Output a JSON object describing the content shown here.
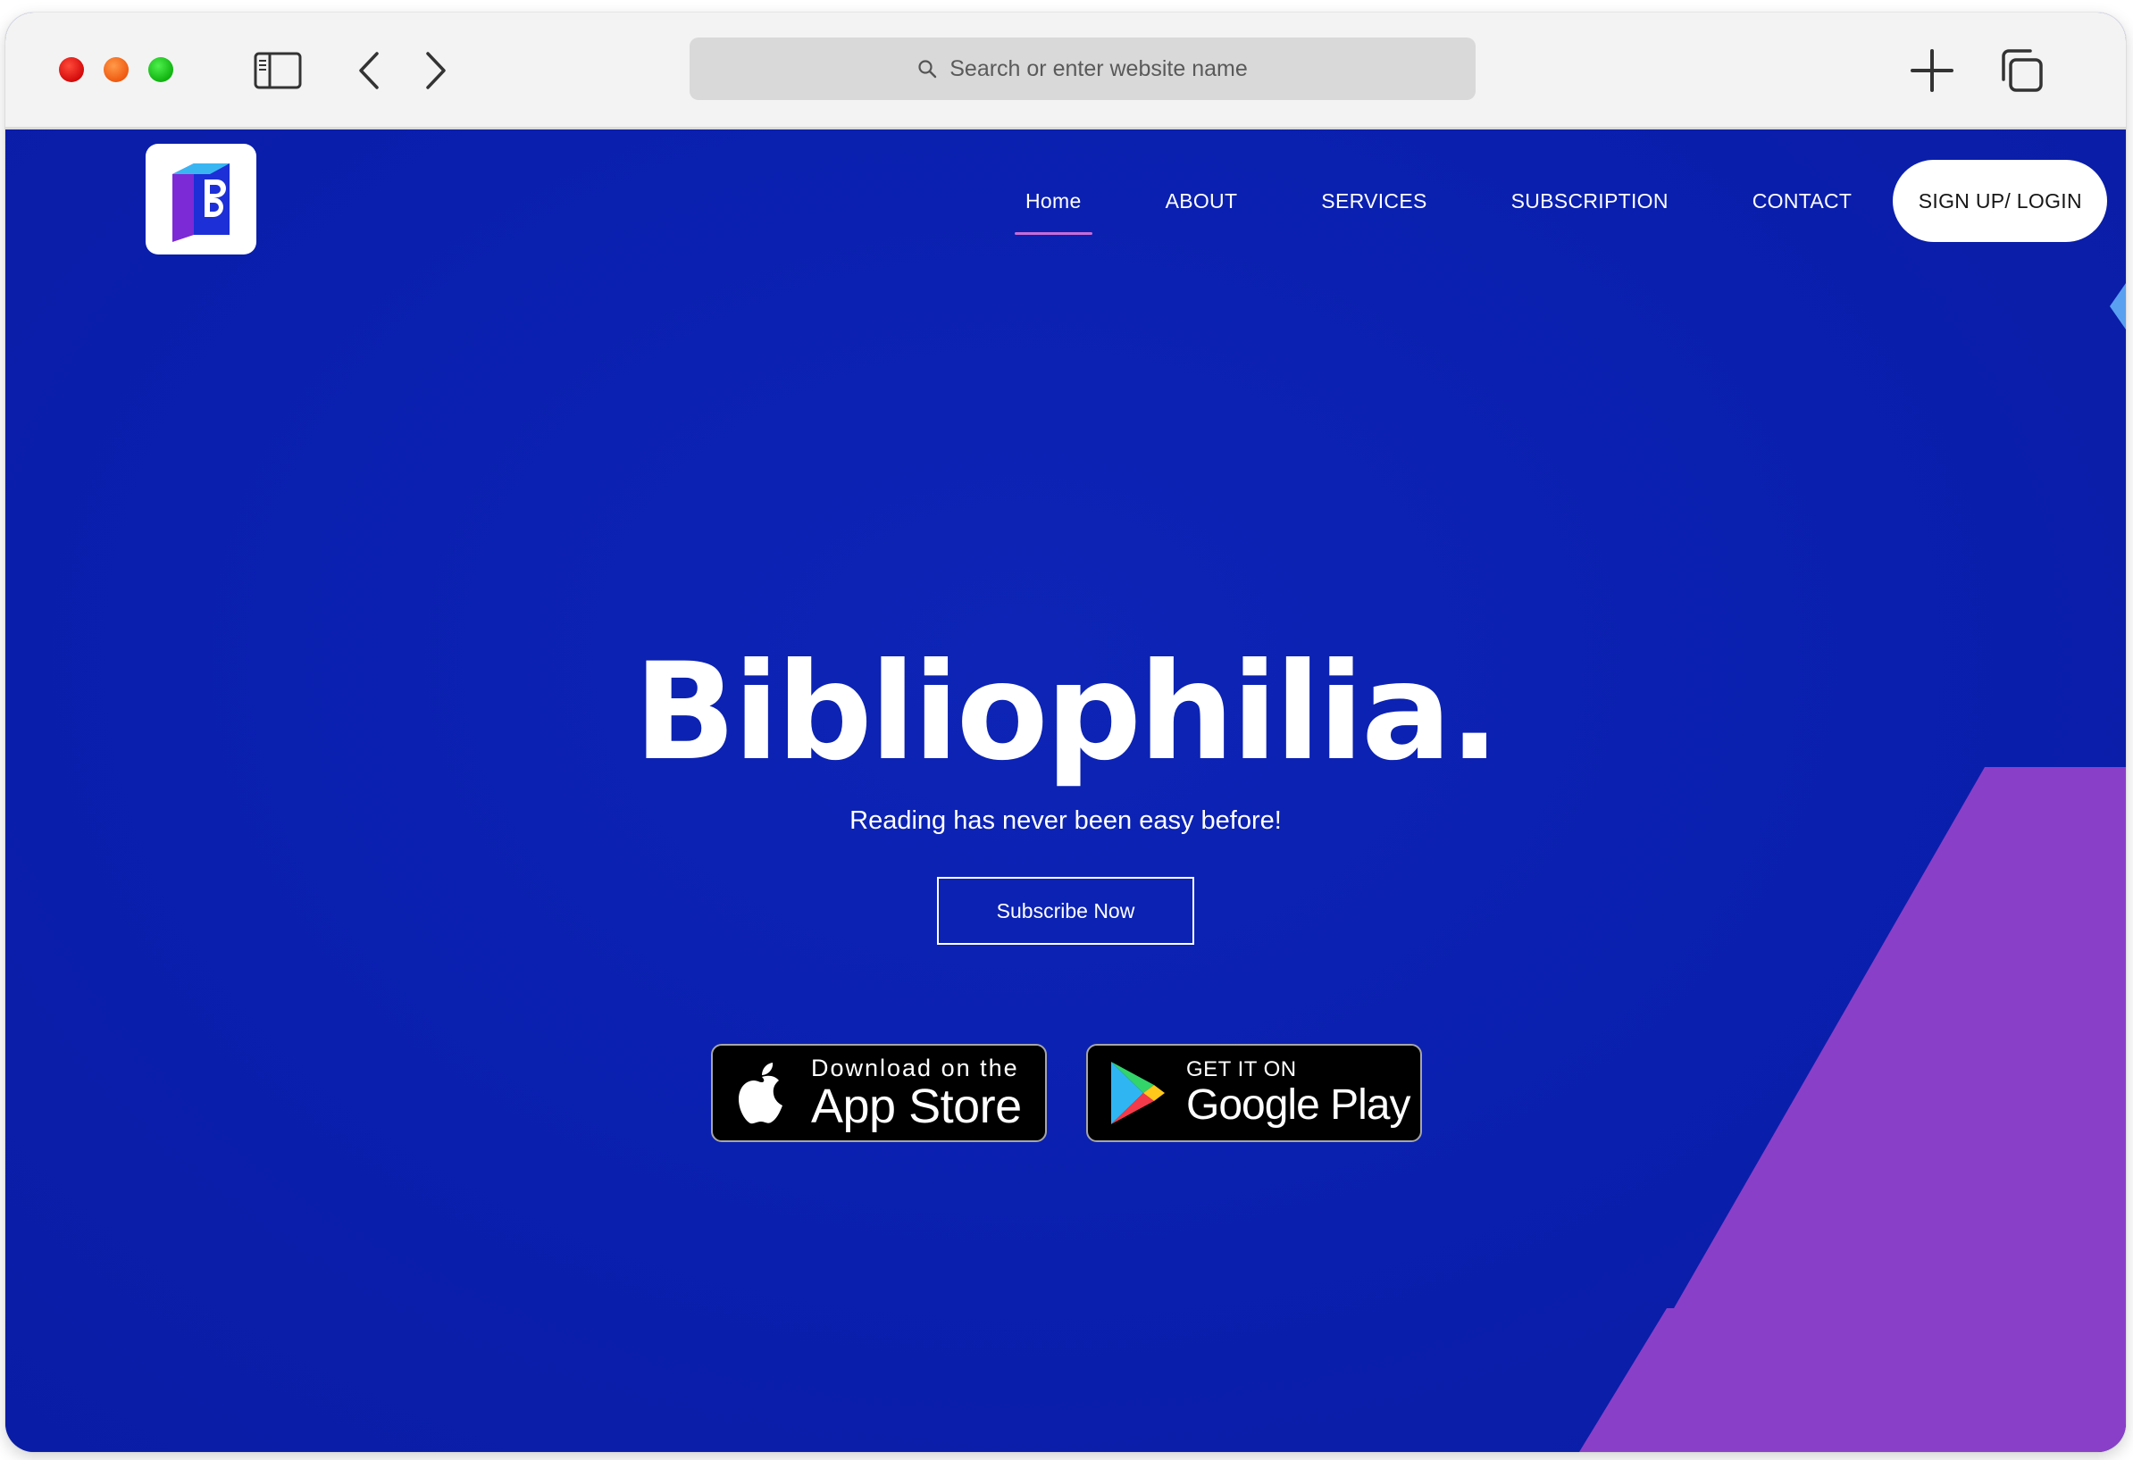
{
  "browser": {
    "url_placeholder": "Search or enter website name",
    "icons": {
      "sidebar": "sidebar-icon",
      "back": "chevron-left-icon",
      "forward": "chevron-right-icon",
      "search": "search-icon",
      "new_tab": "plus-icon",
      "tabs": "tabs-overview-icon"
    }
  },
  "site": {
    "logo_letter": "B",
    "nav": {
      "items": [
        "Home",
        "ABOUT",
        "SERVICES",
        "SUBSCRIPTION",
        "CONTACT"
      ],
      "active": "Home",
      "signup_label": "SIGN UP/ LOGIN"
    },
    "hero": {
      "title": "Bibliophilia.",
      "subtitle": "Reading has never been easy before!",
      "cta_label": "Subscribe Now"
    },
    "badges": {
      "appstore": {
        "small": "Download on the",
        "big": "App Store"
      },
      "googleplay": {
        "small": "GET IT ON",
        "big": "Google Play"
      }
    },
    "colors": {
      "background": "#0a1fae",
      "accent": "#8a3fc8",
      "nav_underline": "#c86bd8"
    }
  }
}
